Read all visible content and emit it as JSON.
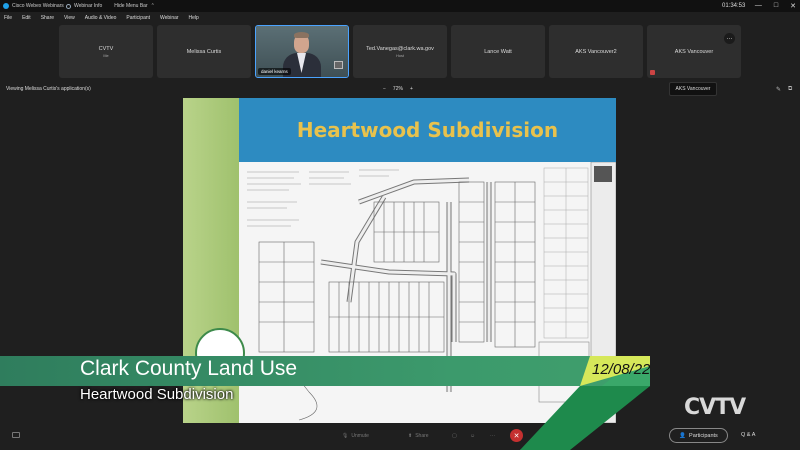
{
  "titlebar": {
    "app_name": "Cisco Webex Webinars",
    "webinar_info": "Webinar Info",
    "hide_menu": "Hide Menu Bar",
    "clock": "01:34:53",
    "minimize": "—",
    "maximize": "□",
    "close": "✕"
  },
  "menubar": [
    "File",
    "Edit",
    "Share",
    "View",
    "Audio & Video",
    "Participant",
    "Webinar",
    "Help"
  ],
  "tiles": [
    {
      "name": "CVTV",
      "sub": "Me"
    },
    {
      "name": "Melissa Curtis",
      "sub": ""
    },
    {
      "name": "daniel kearns",
      "sub": ""
    },
    {
      "name": "Ted.Vanegas@clark.wa.gov",
      "sub": "Host"
    },
    {
      "name": "Lance Watt",
      "sub": ""
    },
    {
      "name": "AKS Vancouver2",
      "sub": ""
    },
    {
      "name": "AKS Vancouver",
      "sub": ""
    }
  ],
  "more_label": "···",
  "viewing": "Viewing Melissa Curtis's application(s)",
  "zoom": {
    "minus": "−",
    "value": "72%",
    "plus": "+"
  },
  "tooltip": "AKS Vancouver",
  "slide": {
    "title": "Heartwood Subdivision"
  },
  "lower_third": {
    "title": "Clark County Land Use",
    "subtitle": "Heartwood Subdivision",
    "date": "12/08/22"
  },
  "controls": {
    "unmute": "Unmute",
    "share": "Share",
    "end": "✕",
    "participants": "Participants",
    "qa": "Q & A"
  },
  "logo": "CVTV"
}
